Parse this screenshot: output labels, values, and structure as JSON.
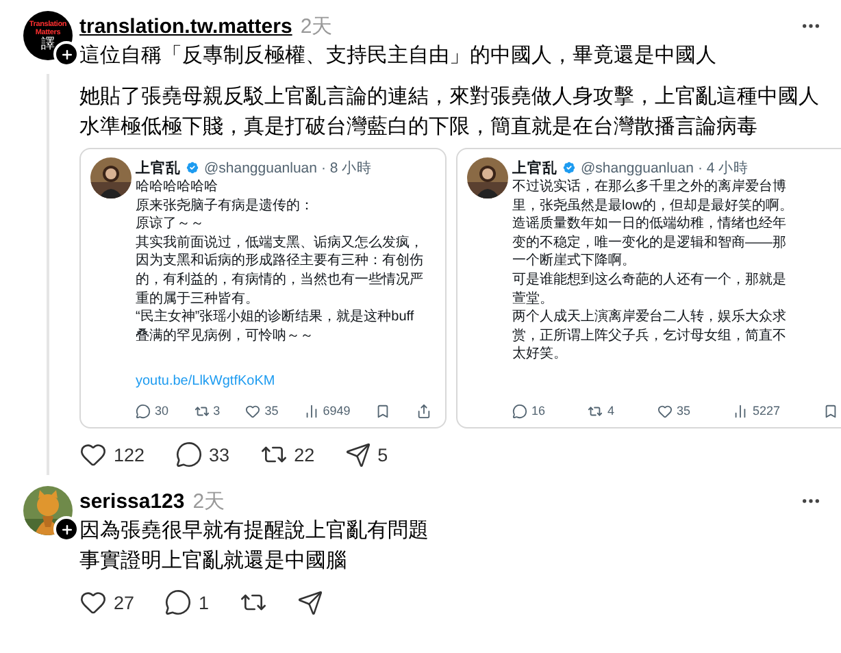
{
  "posts": [
    {
      "username": "translation.tw.matters",
      "time": "2天",
      "avatar": {
        "kind": "logo",
        "caption": "Translation Matters",
        "glyph": "譯"
      },
      "follow": true,
      "thread_line": true,
      "paragraphs": [
        "這位自稱「反專制反極權、支持民主自由」的中國人，畢竟還是中國人",
        "她貼了張堯母親反駁上官亂言論的連結，來對張堯做人身攻擊，上官亂這種中國人水準極低極下賤，真是打破台灣藍白的下限，簡直就是在台灣散播言論病毒"
      ],
      "embeds": [
        {
          "author": "上官乱",
          "handle": "@shangguanluan",
          "time": "· 8 小時",
          "verified": true,
          "lines": [
            "哈哈哈哈哈哈",
            "原来张尧脑子有病是遗传的：",
            "原谅了～～",
            "其实我前面说过，低端支黑、诟病又怎么发疯，",
            "因为支黑和诟病的形成路径主要有三种：有创伤",
            "的，有利益的，有病情的，当然也有一些情况严",
            "重的属于三种皆有。",
            "“民主女神”张瑶小姐的诊断结果，就是这种buff",
            "叠满的罕见病例，可怜呐～～"
          ],
          "link": "youtu.be/LlkWgtfKoKM",
          "stats": [
            {
              "kind": "reply",
              "count": "30"
            },
            {
              "kind": "repost",
              "count": "3"
            },
            {
              "kind": "like",
              "count": "35"
            },
            {
              "kind": "views",
              "count": "6949"
            },
            {
              "kind": "bookmark"
            },
            {
              "kind": "share"
            }
          ]
        },
        {
          "author": "上官乱",
          "handle": "@shangguanluan",
          "time": "· 4 小時",
          "verified": true,
          "lines": [
            "不过说实话，在那么多千里之外的离岸爱台博",
            "里，张尧虽然是最low的，但却是最好笑的啊。",
            "造谣质量数年如一日的低端幼稚，情绪也经年",
            "变的不稳定，唯一变化的是逻辑和智商——那",
            "一个断崖式下降啊。",
            "可是谁能想到这么奇葩的人还有一个，那就是",
            "萱堂。",
            "两个人成天上演离岸爱台二人转，娱乐大众求",
            "赏，正所谓上阵父子兵，乞讨母女组，简直不",
            "太好笑。"
          ],
          "stats": [
            {
              "kind": "reply",
              "count": "16"
            },
            {
              "kind": "repost",
              "count": "4"
            },
            {
              "kind": "like",
              "count": "35"
            },
            {
              "kind": "views",
              "count": "5227"
            },
            {
              "kind": "bookmark"
            }
          ]
        }
      ],
      "actions": [
        {
          "kind": "like",
          "count": "122"
        },
        {
          "kind": "reply",
          "count": "33"
        },
        {
          "kind": "repost",
          "count": "22"
        },
        {
          "kind": "share",
          "count": "5"
        }
      ]
    },
    {
      "username": "serissa123",
      "time": "2天",
      "avatar": {
        "kind": "picture"
      },
      "follow": true,
      "thread_line": false,
      "lines": [
        "因為張堯很早就有提醒說上官亂有問題",
        "事實證明上官亂就還是中國腦"
      ],
      "actions": [
        {
          "kind": "like",
          "count": "27"
        },
        {
          "kind": "reply",
          "count": "1"
        },
        {
          "kind": "repost"
        },
        {
          "kind": "share"
        }
      ]
    }
  ]
}
